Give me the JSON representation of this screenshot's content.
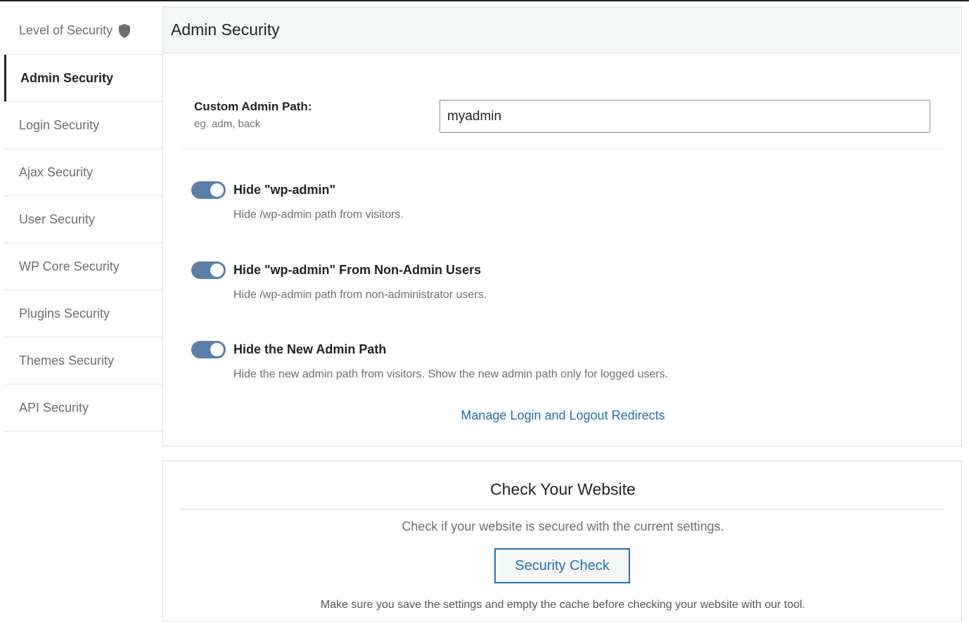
{
  "sidebar": {
    "items": [
      {
        "label": "Level of Security",
        "icon": "shield-icon"
      },
      {
        "label": "Admin Security",
        "active": true
      },
      {
        "label": "Login Security"
      },
      {
        "label": "Ajax Security"
      },
      {
        "label": "User Security"
      },
      {
        "label": "WP Core Security"
      },
      {
        "label": "Plugins Security"
      },
      {
        "label": "Themes Security"
      },
      {
        "label": "API Security"
      }
    ]
  },
  "panel": {
    "title": "Admin Security",
    "custom_path": {
      "label": "Custom Admin Path:",
      "hint": "eg. adm, back",
      "value": "myadmin"
    },
    "toggles": [
      {
        "title": "Hide \"wp-admin\"",
        "description": "Hide /wp-admin path from visitors.",
        "on": true
      },
      {
        "title": "Hide \"wp-admin\" From Non-Admin Users",
        "description": "Hide /wp-admin path from non-administrator users.",
        "on": true
      },
      {
        "title": "Hide the New Admin Path",
        "description": "Hide the new admin path from visitors. Show the new admin path only for logged users.",
        "on": true
      }
    ],
    "manage_link": "Manage Login and Logout Redirects"
  },
  "check": {
    "title": "Check Your Website",
    "description": "Check if your website is secured with the current settings.",
    "button": "Security Check",
    "note": "Make sure you save the settings and empty the cache before checking your website with our tool."
  },
  "colors": {
    "accent": "#2271b1",
    "toggle_on": "#5b7fa8",
    "text": "#1d2327",
    "muted": "#6b7075"
  }
}
